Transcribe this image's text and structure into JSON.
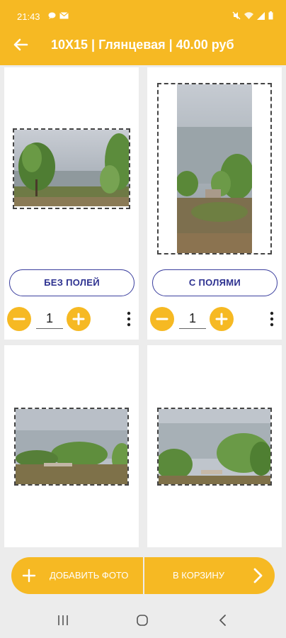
{
  "status_bar": {
    "time": "21:43",
    "left_icons": [
      "chat-bubble-icon",
      "mail-icon"
    ],
    "right_icons": [
      "mute-icon",
      "wifi-icon",
      "signal-icon",
      "battery-icon"
    ]
  },
  "app_bar": {
    "title": "10X15 | Глянцевая | 40.00 руб"
  },
  "photos": [
    {
      "mode_label": "БЕЗ ПОЛЕЙ",
      "quantity": "1"
    },
    {
      "mode_label": "С ПОЛЯМИ",
      "quantity": "1"
    },
    {
      "mode_label": "",
      "quantity": ""
    },
    {
      "mode_label": "",
      "quantity": ""
    }
  ],
  "bottom_bar": {
    "add_photo_label": "ДОБАВИТЬ ФОТО",
    "to_cart_label": "В КОРЗИНУ"
  },
  "colors": {
    "accent": "#f6b923",
    "button_border": "#3b3f9e"
  }
}
